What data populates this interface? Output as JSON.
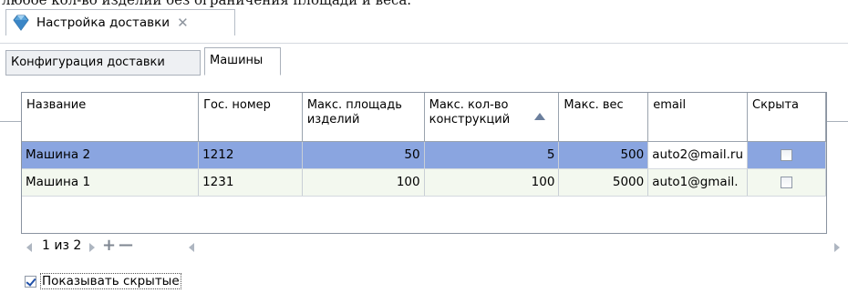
{
  "clipped_text": "любое кол-во изделий без ограничения площади и веса.",
  "document_tab": {
    "title": "Настройка доставки",
    "close": "✕",
    "icon": "gem-icon"
  },
  "subtabs": [
    {
      "label": "Конфигурация доставки",
      "active": false
    },
    {
      "label": "Машины",
      "active": true
    }
  ],
  "table": {
    "columns": [
      "Название",
      "Гос. номер",
      "Макс. площадь изделий",
      "Макс. кол-во конструкций",
      "Макс. вес",
      "email",
      "Скрыта"
    ],
    "sorted_column": "Макс. кол-во конструкций",
    "rows": [
      {
        "name": "Машина 2",
        "plate": "1212",
        "max_area": "50",
        "max_count": "5",
        "max_weight": "500",
        "email": "auto2@mail.ru",
        "hidden": false,
        "selected": true
      },
      {
        "name": "Машина 1",
        "plate": "1231",
        "max_area": "100",
        "max_count": "100",
        "max_weight": "5000",
        "email": "auto1@gmail.",
        "hidden": false,
        "selected": false
      }
    ]
  },
  "pager": {
    "text": "1 из 2",
    "add": "+",
    "remove": "—"
  },
  "show_hidden": {
    "label": "Показывать скрытые",
    "checked": true
  }
}
